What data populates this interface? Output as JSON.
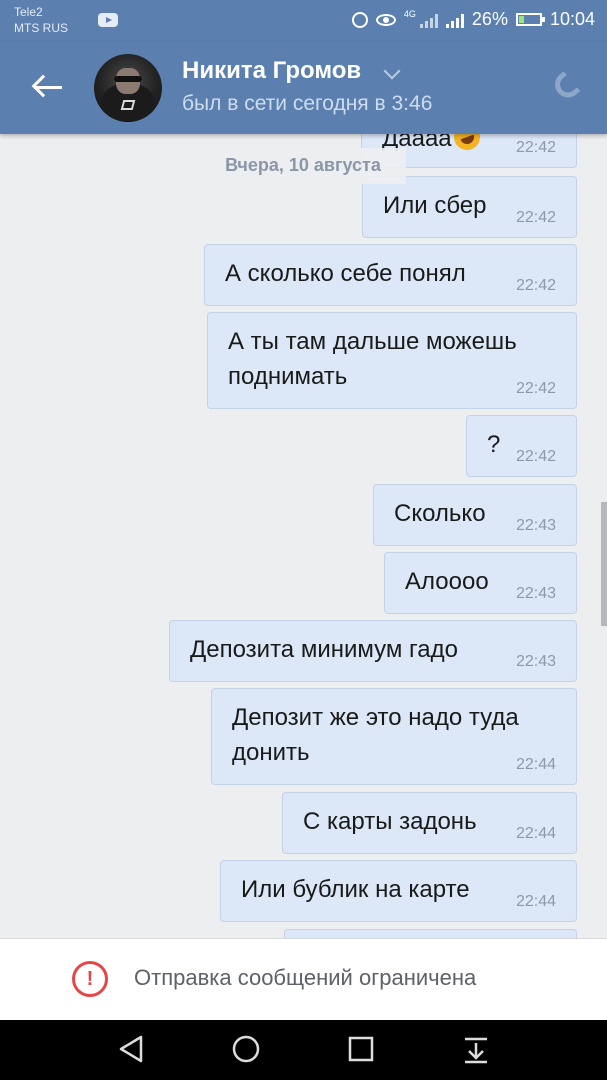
{
  "status_bar": {
    "carrier_1": "Tele2",
    "carrier_2": "MTS RUS",
    "network_label": "4G",
    "battery_level": 0.26,
    "battery_percent": "26%",
    "time": "10:04"
  },
  "header": {
    "contact_name": "Никита Громов",
    "last_seen": "был в сети сегодня в 3:46"
  },
  "chat": {
    "date_separator": "Вчера, 10 августа",
    "messages": [
      {
        "text": "Даааа",
        "time": "22:42",
        "emoji": "rolling-on-floor-laughing"
      },
      {
        "text": "Или сбер",
        "time": "22:42"
      },
      {
        "text": "А сколько себе понял",
        "time": "22:42"
      },
      {
        "text_line_1": "А ты там дальше можешь",
        "text_line_2": "поднимать",
        "time": "22:42"
      },
      {
        "text": "?",
        "time": "22:42"
      },
      {
        "text": "Сколько",
        "time": "22:43"
      },
      {
        "text": "Алоооо",
        "time": "22:43"
      },
      {
        "text": "Депозита минимум гадо",
        "time": "22:43"
      },
      {
        "text_line_1": "Депозит же это надо туда",
        "text_line_2": "донить",
        "time": "22:44"
      },
      {
        "text": "С карты задонь",
        "time": "22:44"
      },
      {
        "text": "Или бублик на карте",
        "time": "22:44"
      }
    ]
  },
  "restricted_bar": {
    "icon_symbol": "!",
    "text": "Отправка сообщений ограничена"
  },
  "colors": {
    "header_bg": "#5b7fae",
    "bubble_bg": "#dce8f7",
    "warning_red": "#e64646"
  }
}
